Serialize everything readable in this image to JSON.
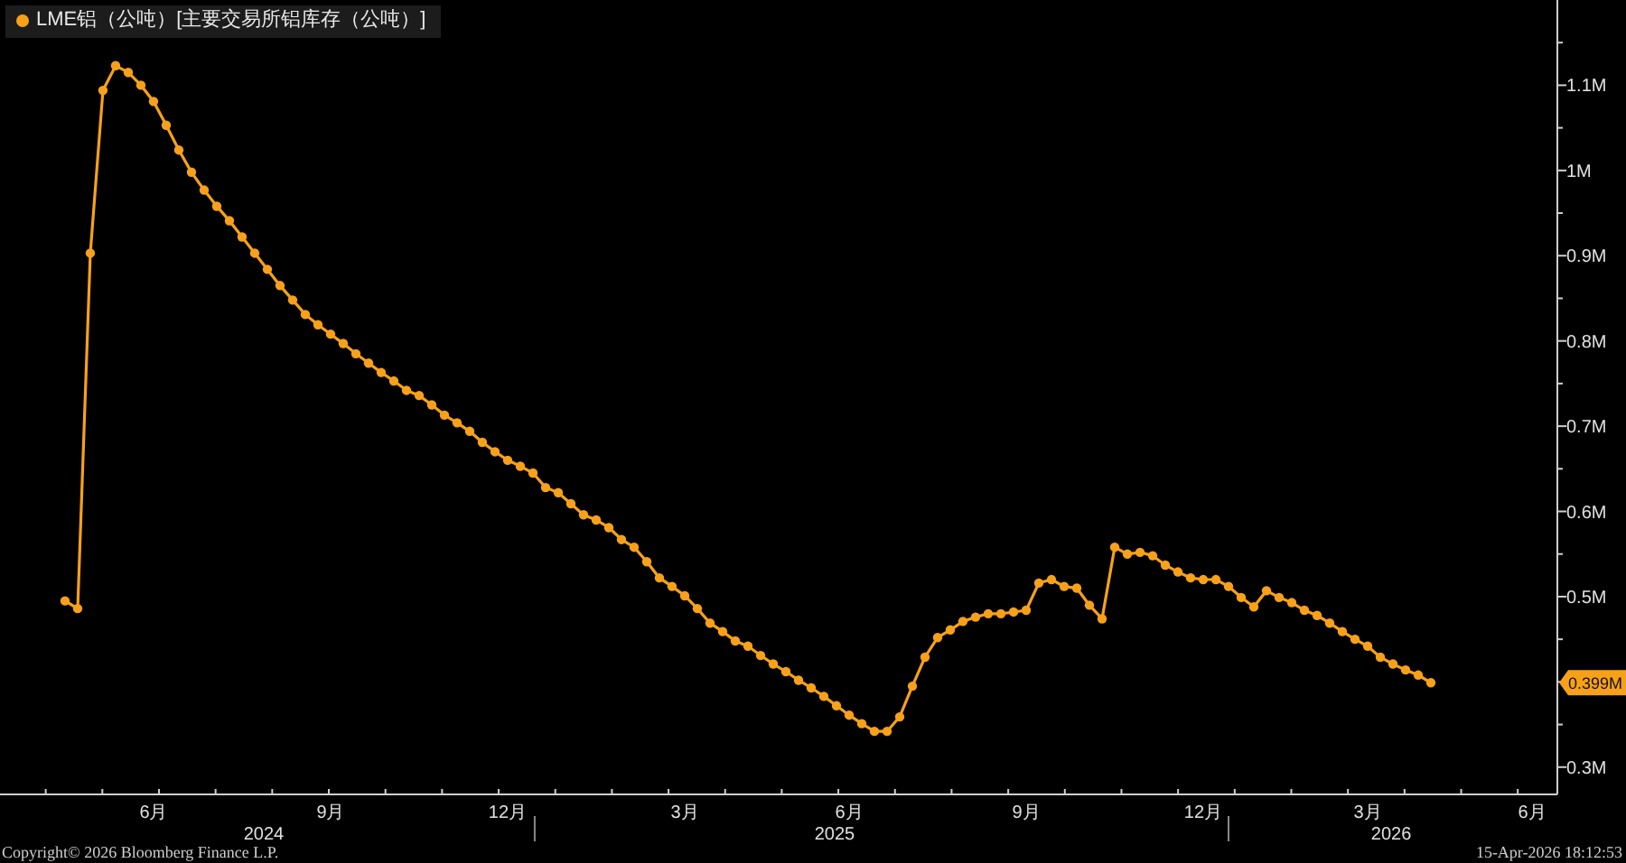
{
  "chart": {
    "chart_data": {
      "type": "line",
      "categories": [
        null,
        null,
        null,
        null,
        null,
        null,
        null,
        "6月",
        null,
        null,
        null,
        null,
        null,
        null,
        null,
        null,
        null,
        null,
        null,
        null,
        null,
        "9月",
        null,
        null,
        null,
        null,
        null,
        null,
        null,
        null,
        null,
        null,
        null,
        null,
        null,
        "12月",
        null,
        null,
        null,
        null,
        null,
        null,
        null,
        null,
        null,
        null,
        null,
        null,
        null,
        "3月",
        null,
        null,
        null,
        null,
        null,
        null,
        null,
        null,
        null,
        null,
        null,
        null,
        "6月",
        null,
        null,
        null,
        null,
        null,
        null,
        null,
        null,
        null,
        null,
        null,
        null,
        null,
        "9月",
        null,
        null,
        null,
        null,
        null,
        null,
        null,
        null,
        null,
        null,
        null,
        null,
        null,
        "12月",
        null,
        null,
        null,
        null,
        null,
        null,
        null,
        null,
        null,
        null,
        null,
        null,
        "3月",
        null,
        null,
        null,
        null,
        null,
        null,
        null,
        null,
        null,
        null,
        null,
        null,
        "6月",
        null,
        null
      ],
      "series": [
        {
          "name": "LME铝（公吨）[主要交易所铝库存（公吨）]",
          "color": "#f7a11a",
          "marker": "circle",
          "values": [
            0.495,
            0.486,
            0.903,
            1.094,
            1.123,
            1.115,
            1.1,
            1.081,
            1.053,
            1.024,
            0.998,
            0.977,
            0.958,
            0.941,
            0.922,
            0.903,
            0.884,
            0.865,
            0.848,
            0.831,
            0.819,
            0.808,
            0.797,
            0.785,
            0.774,
            0.763,
            0.753,
            0.742,
            0.736,
            0.725,
            0.713,
            0.704,
            0.694,
            0.681,
            0.67,
            0.66,
            0.653,
            0.645,
            0.628,
            0.622,
            0.609,
            0.596,
            0.59,
            0.581,
            0.567,
            0.558,
            0.541,
            0.522,
            0.512,
            0.501,
            0.486,
            0.469,
            0.459,
            0.448,
            0.442,
            0.431,
            0.421,
            0.412,
            0.402,
            0.393,
            0.383,
            0.372,
            0.361,
            0.351,
            0.342,
            0.342,
            0.359,
            0.395,
            0.429,
            0.452,
            0.461,
            0.471,
            0.476,
            0.48,
            0.48,
            0.482,
            0.484,
            0.516,
            0.52,
            0.512,
            0.51,
            0.49,
            0.474,
            0.558,
            0.55,
            0.552,
            0.548,
            0.537,
            0.529,
            0.522,
            0.52,
            0.52,
            0.512,
            0.499,
            0.488,
            0.507,
            0.499,
            0.493,
            0.484,
            0.478,
            0.469,
            0.459,
            0.45,
            0.442,
            0.429,
            0.421,
            0.414,
            0.408,
            0.399,
            null,
            null,
            null,
            null,
            null,
            null,
            null,
            null,
            null,
            null
          ]
        }
      ],
      "ylim": [
        0.268,
        1.2
      ],
      "yticks": [
        {
          "value": 0.3,
          "label": "0.3M"
        },
        {
          "value": 0.5,
          "label": "0.5M"
        },
        {
          "value": 0.6,
          "label": "0.6M"
        },
        {
          "value": 0.7,
          "label": "0.7M"
        },
        {
          "value": 0.8,
          "label": "0.8M"
        },
        {
          "value": 0.9,
          "label": "0.9M"
        },
        {
          "value": 1.0,
          "label": "1M"
        },
        {
          "value": 1.1,
          "label": "1.1M"
        }
      ]
    },
    "last_value_badge": "0.399M",
    "year_labels": [
      "2024",
      "2025",
      "2026"
    ]
  },
  "footer": {
    "copyright": "Copyright© 2026 Bloomberg Finance L.P.",
    "timestamp": "15-Apr-2026 18:12:53"
  }
}
